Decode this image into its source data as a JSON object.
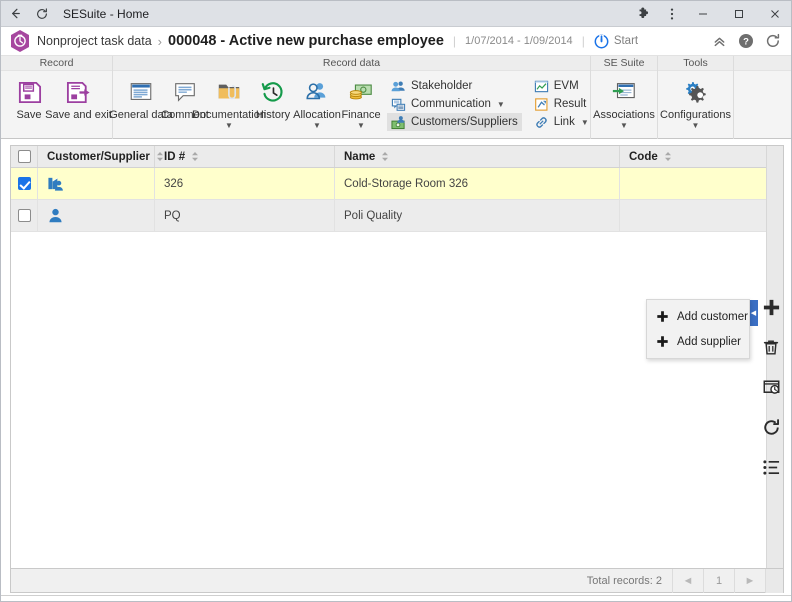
{
  "browser": {
    "back_icon": "arrow-left-icon",
    "reload_icon": "reload-icon",
    "tab_title": "SESuite - Home",
    "extensions_icon": "puzzle-icon",
    "menu_icon": "three-dots-vertical-icon",
    "minimize_label": "–",
    "maximize_label": "□",
    "close_label": "✕"
  },
  "header": {
    "logo_icon": "sesuite-hexagon-clock-logo",
    "breadcrumb_parent": "Nonproject task data",
    "breadcrumb_separator": "›",
    "breadcrumb_current": "000048 - Active new purchase employee",
    "divider": "|",
    "date_range": "1/07/2014 - 1/09/2014",
    "divider2": "|",
    "status_icon": "power-icon",
    "status_label": "Start",
    "collapse_icon": "chevron-double-up-icon",
    "help_icon": "help-circle-icon",
    "refresh_icon": "refresh-icon"
  },
  "ribbon": {
    "groups": [
      {
        "title": "Record",
        "items": [
          {
            "label": "Save",
            "icon": "save-floppy-icon",
            "caret": false
          },
          {
            "label": "Save and exit",
            "icon": "save-and-exit-icon",
            "caret": false
          }
        ]
      },
      {
        "title": "Record data",
        "items": [
          {
            "label": "General data",
            "icon": "general-data-window-icon",
            "caret": false
          },
          {
            "label": "Comment",
            "icon": "comment-balloon-icon",
            "caret": false
          },
          {
            "label": "Documentation",
            "icon": "documentation-folder-clip-icon",
            "caret": true
          },
          {
            "label": "History",
            "icon": "history-clock-icon",
            "caret": false
          },
          {
            "label": "Allocation",
            "icon": "allocation-people-icon",
            "caret": true
          },
          {
            "label": "Finance",
            "icon": "finance-money-icon",
            "caret": true
          }
        ],
        "small_items": [
          {
            "label": "Stakeholder",
            "icon": "stakeholder-people-icon",
            "caret": false,
            "active": false
          },
          {
            "label": "Communication",
            "icon": "communication-icon",
            "caret": true,
            "active": false
          },
          {
            "label": "Customers/Suppliers",
            "icon": "customers-suppliers-icon",
            "caret": false,
            "active": true
          }
        ],
        "small_items2": [
          {
            "label": "EVM",
            "icon": "evm-chart-icon",
            "caret": false,
            "active": false
          },
          {
            "label": "Result",
            "icon": "result-icon",
            "caret": false,
            "active": false
          },
          {
            "label": "Link",
            "icon": "link-chain-icon",
            "caret": true,
            "active": false
          }
        ]
      },
      {
        "title": "SE Suite",
        "items": [
          {
            "label": "Associations",
            "icon": "associations-icon",
            "caret": true
          }
        ]
      },
      {
        "title": "Tools",
        "items": [
          {
            "label": "Configurations",
            "icon": "configurations-gears-icon",
            "caret": true
          }
        ]
      }
    ]
  },
  "grid": {
    "columns": [
      {
        "key": "check",
        "label": "",
        "sortable": false
      },
      {
        "key": "customer_supplier",
        "label": "Customer/Supplier",
        "sortable": true
      },
      {
        "key": "id",
        "label": "ID #",
        "sortable": true
      },
      {
        "key": "name",
        "label": "Name",
        "sortable": true
      },
      {
        "key": "code",
        "label": "Code",
        "sortable": true
      }
    ],
    "select_all_checked": false,
    "rows": [
      {
        "checked": true,
        "type_icon": "company-person-icon",
        "id": "326",
        "name": "Cold-Storage Room 326",
        "code": "",
        "selected": true
      },
      {
        "checked": false,
        "type_icon": "person-icon",
        "id": "PQ",
        "name": "Poli Quality",
        "code": "",
        "selected": false
      }
    ]
  },
  "dropdown": {
    "visible": true,
    "items": [
      {
        "label": "Add customer",
        "icon": "plus-icon"
      },
      {
        "label": "Add supplier",
        "icon": "plus-icon"
      }
    ]
  },
  "vtoolbar": {
    "collapse_handle_icon": "chevron-left-icon",
    "buttons": [
      {
        "name": "add-button",
        "icon": "plus-icon"
      },
      {
        "name": "delete-button",
        "icon": "trash-icon"
      },
      {
        "name": "preview-button",
        "icon": "preview-window-icon"
      },
      {
        "name": "refresh-button",
        "icon": "refresh-icon"
      },
      {
        "name": "list-options-button",
        "icon": "list-icon"
      }
    ]
  },
  "footer": {
    "total_records": "Total records: 2",
    "prev_icon": "◄",
    "page_number": "1",
    "next_icon": "►"
  },
  "colors": {
    "accent_purple": "#9c3fa0",
    "accent_blue": "#1a73e8",
    "selected_row": "#ffffcc",
    "handle_blue": "#3b6fc4"
  }
}
